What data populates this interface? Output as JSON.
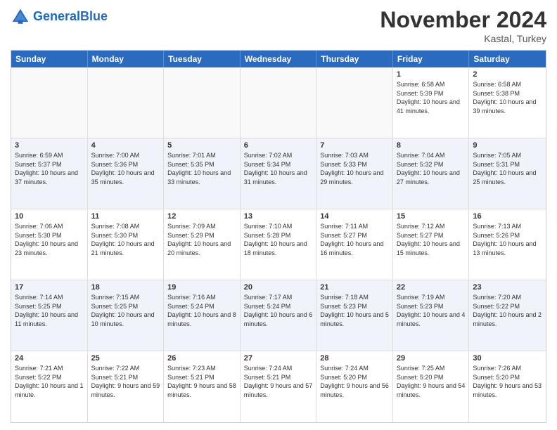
{
  "header": {
    "logo_general": "General",
    "logo_blue": "Blue",
    "month_title": "November 2024",
    "location": "Kastal, Turkey"
  },
  "days_of_week": [
    "Sunday",
    "Monday",
    "Tuesday",
    "Wednesday",
    "Thursday",
    "Friday",
    "Saturday"
  ],
  "weeks": [
    [
      {
        "day": "",
        "info": ""
      },
      {
        "day": "",
        "info": ""
      },
      {
        "day": "",
        "info": ""
      },
      {
        "day": "",
        "info": ""
      },
      {
        "day": "",
        "info": ""
      },
      {
        "day": "1",
        "info": "Sunrise: 6:58 AM\nSunset: 5:39 PM\nDaylight: 10 hours and 41 minutes."
      },
      {
        "day": "2",
        "info": "Sunrise: 6:58 AM\nSunset: 5:38 PM\nDaylight: 10 hours and 39 minutes."
      }
    ],
    [
      {
        "day": "3",
        "info": "Sunrise: 6:59 AM\nSunset: 5:37 PM\nDaylight: 10 hours and 37 minutes."
      },
      {
        "day": "4",
        "info": "Sunrise: 7:00 AM\nSunset: 5:36 PM\nDaylight: 10 hours and 35 minutes."
      },
      {
        "day": "5",
        "info": "Sunrise: 7:01 AM\nSunset: 5:35 PM\nDaylight: 10 hours and 33 minutes."
      },
      {
        "day": "6",
        "info": "Sunrise: 7:02 AM\nSunset: 5:34 PM\nDaylight: 10 hours and 31 minutes."
      },
      {
        "day": "7",
        "info": "Sunrise: 7:03 AM\nSunset: 5:33 PM\nDaylight: 10 hours and 29 minutes."
      },
      {
        "day": "8",
        "info": "Sunrise: 7:04 AM\nSunset: 5:32 PM\nDaylight: 10 hours and 27 minutes."
      },
      {
        "day": "9",
        "info": "Sunrise: 7:05 AM\nSunset: 5:31 PM\nDaylight: 10 hours and 25 minutes."
      }
    ],
    [
      {
        "day": "10",
        "info": "Sunrise: 7:06 AM\nSunset: 5:30 PM\nDaylight: 10 hours and 23 minutes."
      },
      {
        "day": "11",
        "info": "Sunrise: 7:08 AM\nSunset: 5:30 PM\nDaylight: 10 hours and 21 minutes."
      },
      {
        "day": "12",
        "info": "Sunrise: 7:09 AM\nSunset: 5:29 PM\nDaylight: 10 hours and 20 minutes."
      },
      {
        "day": "13",
        "info": "Sunrise: 7:10 AM\nSunset: 5:28 PM\nDaylight: 10 hours and 18 minutes."
      },
      {
        "day": "14",
        "info": "Sunrise: 7:11 AM\nSunset: 5:27 PM\nDaylight: 10 hours and 16 minutes."
      },
      {
        "day": "15",
        "info": "Sunrise: 7:12 AM\nSunset: 5:27 PM\nDaylight: 10 hours and 15 minutes."
      },
      {
        "day": "16",
        "info": "Sunrise: 7:13 AM\nSunset: 5:26 PM\nDaylight: 10 hours and 13 minutes."
      }
    ],
    [
      {
        "day": "17",
        "info": "Sunrise: 7:14 AM\nSunset: 5:25 PM\nDaylight: 10 hours and 11 minutes."
      },
      {
        "day": "18",
        "info": "Sunrise: 7:15 AM\nSunset: 5:25 PM\nDaylight: 10 hours and 10 minutes."
      },
      {
        "day": "19",
        "info": "Sunrise: 7:16 AM\nSunset: 5:24 PM\nDaylight: 10 hours and 8 minutes."
      },
      {
        "day": "20",
        "info": "Sunrise: 7:17 AM\nSunset: 5:24 PM\nDaylight: 10 hours and 6 minutes."
      },
      {
        "day": "21",
        "info": "Sunrise: 7:18 AM\nSunset: 5:23 PM\nDaylight: 10 hours and 5 minutes."
      },
      {
        "day": "22",
        "info": "Sunrise: 7:19 AM\nSunset: 5:23 PM\nDaylight: 10 hours and 4 minutes."
      },
      {
        "day": "23",
        "info": "Sunrise: 7:20 AM\nSunset: 5:22 PM\nDaylight: 10 hours and 2 minutes."
      }
    ],
    [
      {
        "day": "24",
        "info": "Sunrise: 7:21 AM\nSunset: 5:22 PM\nDaylight: 10 hours and 1 minute."
      },
      {
        "day": "25",
        "info": "Sunrise: 7:22 AM\nSunset: 5:21 PM\nDaylight: 9 hours and 59 minutes."
      },
      {
        "day": "26",
        "info": "Sunrise: 7:23 AM\nSunset: 5:21 PM\nDaylight: 9 hours and 58 minutes."
      },
      {
        "day": "27",
        "info": "Sunrise: 7:24 AM\nSunset: 5:21 PM\nDaylight: 9 hours and 57 minutes."
      },
      {
        "day": "28",
        "info": "Sunrise: 7:24 AM\nSunset: 5:20 PM\nDaylight: 9 hours and 56 minutes."
      },
      {
        "day": "29",
        "info": "Sunrise: 7:25 AM\nSunset: 5:20 PM\nDaylight: 9 hours and 54 minutes."
      },
      {
        "day": "30",
        "info": "Sunrise: 7:26 AM\nSunset: 5:20 PM\nDaylight: 9 hours and 53 minutes."
      }
    ]
  ]
}
